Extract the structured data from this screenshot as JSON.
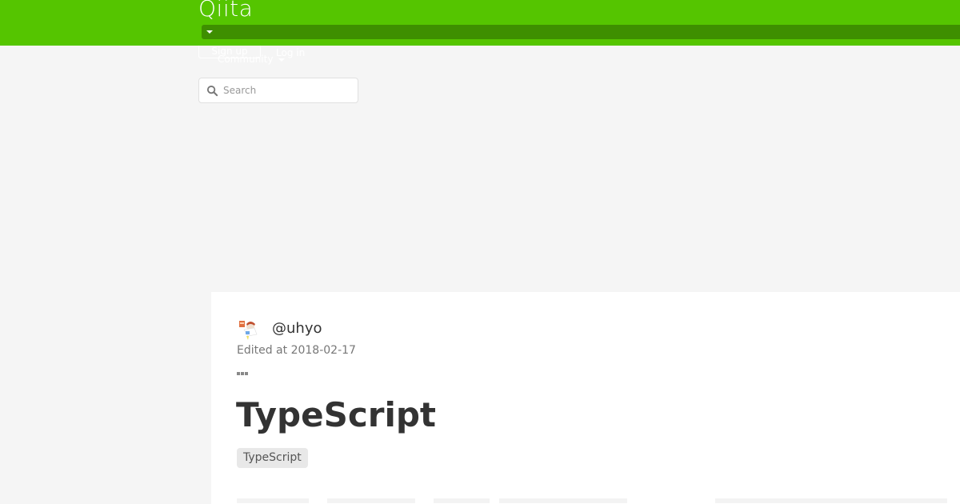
{
  "header": {
    "logo": "Qiita",
    "signup_label": "Sign up",
    "login_label": "Log in",
    "community_label": "Community",
    "brand_color": "#55c500"
  },
  "search": {
    "placeholder": "Search"
  },
  "article": {
    "author": "@uhyo",
    "edited": "Edited at 2018-02-17",
    "title": "TypeScript",
    "tags": [
      "TypeScript"
    ]
  }
}
